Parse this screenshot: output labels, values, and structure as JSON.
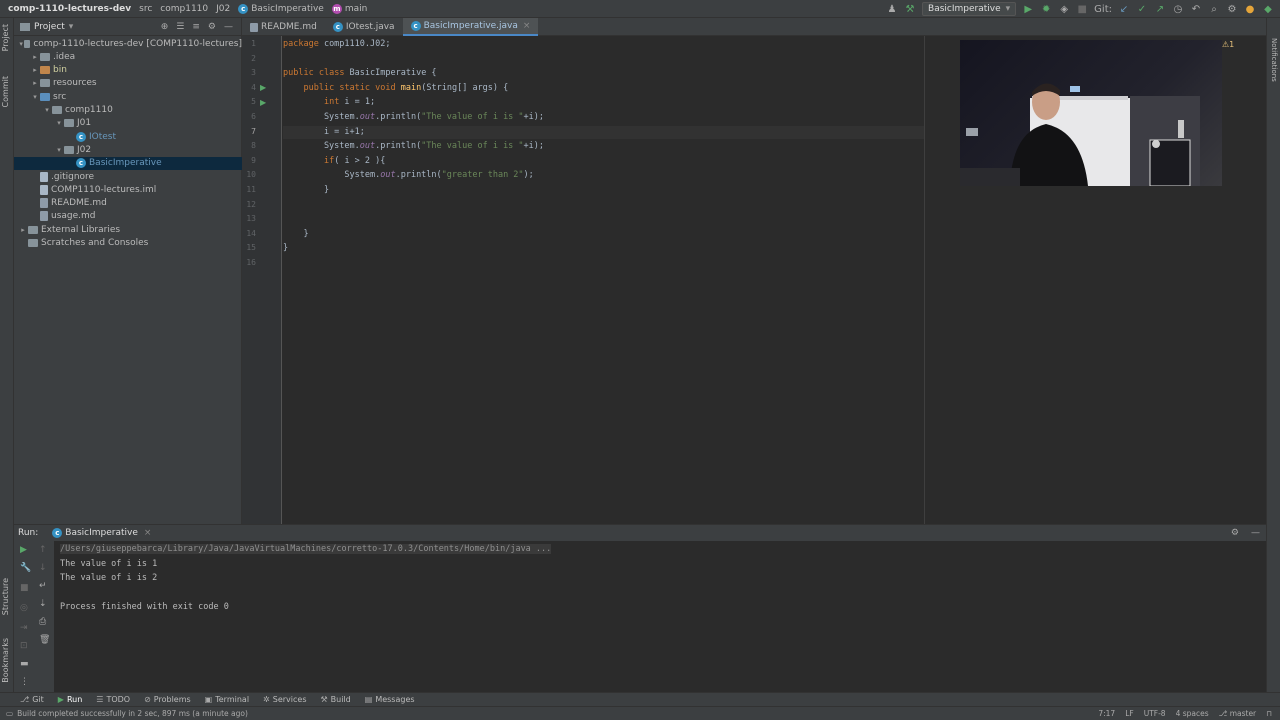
{
  "titlebar": {
    "project": "comp-1110-lectures-dev",
    "breadcrumbs": [
      "src",
      "comp1110",
      "J02",
      "BasicImperative",
      "main"
    ],
    "run_config": "BasicImperative",
    "git_label": "Git:"
  },
  "project_panel": {
    "title": "Project",
    "tree": [
      {
        "label": "comp-1110-lectures-dev [COMP1110-lectures]",
        "depth": 0,
        "kind": "folder",
        "arrow": "▾"
      },
      {
        "label": ".idea",
        "depth": 1,
        "kind": "folder",
        "arrow": "▸"
      },
      {
        "label": "bin",
        "depth": 1,
        "kind": "folder-excluded",
        "arrow": "▸"
      },
      {
        "label": "resources",
        "depth": 1,
        "kind": "folder",
        "arrow": "▸"
      },
      {
        "label": "src",
        "depth": 1,
        "kind": "folder-src",
        "arrow": "▾"
      },
      {
        "label": "comp1110",
        "depth": 2,
        "kind": "folder",
        "arrow": "▾"
      },
      {
        "label": "J01",
        "depth": 3,
        "kind": "folder",
        "arrow": "▾"
      },
      {
        "label": "IOtest",
        "depth": 4,
        "kind": "class",
        "arrow": ""
      },
      {
        "label": "J02",
        "depth": 3,
        "kind": "folder",
        "arrow": "▾"
      },
      {
        "label": "BasicImperative",
        "depth": 4,
        "kind": "class",
        "arrow": "",
        "selected": true
      },
      {
        "label": ".gitignore",
        "depth": 1,
        "kind": "file",
        "arrow": ""
      },
      {
        "label": "COMP1110-lectures.iml",
        "depth": 1,
        "kind": "file",
        "arrow": ""
      },
      {
        "label": "README.md",
        "depth": 1,
        "kind": "md",
        "arrow": ""
      },
      {
        "label": "usage.md",
        "depth": 1,
        "kind": "md",
        "arrow": ""
      },
      {
        "label": "External Libraries",
        "depth": 0,
        "kind": "folder",
        "arrow": "▸"
      },
      {
        "label": "Scratches and Consoles",
        "depth": 0,
        "kind": "folder",
        "arrow": ""
      }
    ]
  },
  "editor": {
    "tabs": [
      {
        "label": "README.md",
        "active": false
      },
      {
        "label": "IOtest.java",
        "active": false
      },
      {
        "label": "BasicImperative.java",
        "active": true
      }
    ],
    "current_line": 7,
    "lines": [
      "package comp1110.J02;",
      "",
      "public class BasicImperative {",
      "    public static void main(String[] args) {",
      "        int i = 1;",
      "        System.out.println(\"The value of i is \"+i);",
      "        i = i+1;",
      "        System.out.println(\"The value of i is \"+i);",
      "        if( i > 2 ){",
      "            System.out.println(\"greater than 2\");",
      "        }",
      "",
      "",
      "    }",
      "}",
      ""
    ],
    "line_numbers": [
      "1",
      "2",
      "3",
      "4",
      "5",
      "6",
      "7",
      "8",
      "9",
      "10",
      "11",
      "12",
      "13",
      "14",
      "15",
      "16"
    ],
    "warning_count": "1"
  },
  "run_panel": {
    "label": "Run:",
    "tab": "BasicImperative",
    "console": [
      "/Users/giuseppebarca/Library/Java/JavaVirtualMachines/corretto-17.0.3/Contents/Home/bin/java ...",
      "The value of i is 1",
      "The value of i is 2",
      "",
      "Process finished with exit code 0"
    ]
  },
  "left_stripe": {
    "project": "Project",
    "commit": "Commit",
    "structure": "Structure",
    "bookmarks": "Bookmarks"
  },
  "right_stripe": {
    "notifications": "Notifications"
  },
  "bottom_tools": [
    "Git",
    "Run",
    "TODO",
    "Problems",
    "Terminal",
    "Services",
    "Build",
    "Messages"
  ],
  "status": {
    "message": "Build completed successfully in 2 sec, 897 ms (a minute ago)",
    "position": "7:17",
    "line_sep": "LF",
    "encoding": "UTF-8",
    "indent": "4 spaces",
    "branch": "master"
  }
}
